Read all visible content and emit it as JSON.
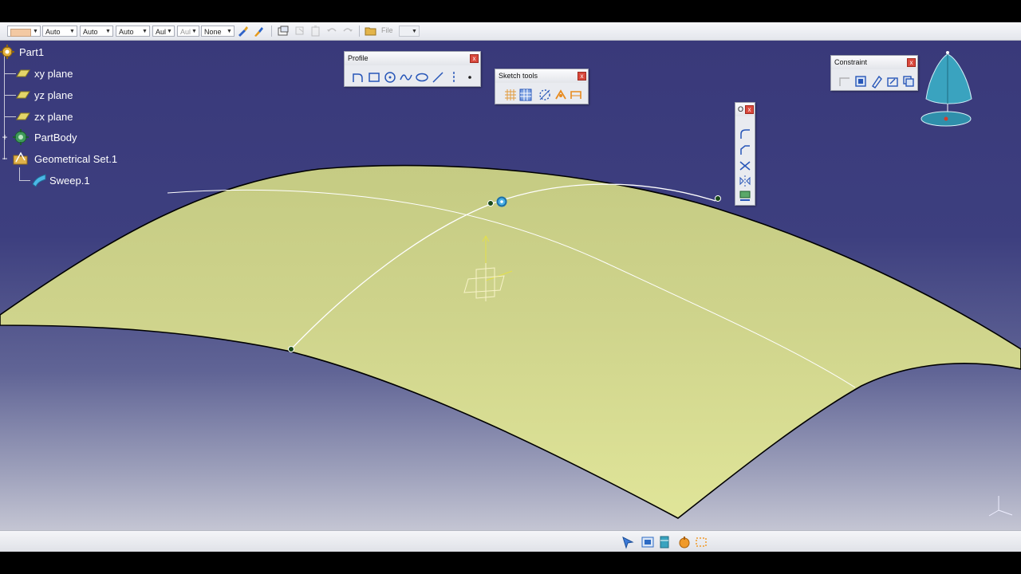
{
  "toolbar": {
    "combos": [
      {
        "name": "color-combo",
        "value": ""
      },
      {
        "name": "transparency-combo",
        "value": "Auto"
      },
      {
        "name": "linewidth-combo",
        "value": "Auto"
      },
      {
        "name": "linetype-combo",
        "value": "Auto"
      },
      {
        "name": "layer-combo",
        "value": "Aul"
      },
      {
        "name": "render-combo",
        "value": "Aul"
      },
      {
        "name": "filter-combo",
        "value": "None"
      }
    ],
    "file_label": "File"
  },
  "tree": {
    "root": "Part1",
    "items": [
      {
        "label": "xy plane",
        "icon": "plane-icon"
      },
      {
        "label": "yz plane",
        "icon": "plane-icon"
      },
      {
        "label": "zx plane",
        "icon": "plane-icon"
      },
      {
        "label": "PartBody",
        "icon": "partbody-icon"
      },
      {
        "label": "Geometrical Set.1",
        "icon": "geometrical-set-icon"
      },
      {
        "label": "Sweep.1",
        "icon": "sweep-icon"
      }
    ]
  },
  "toolbars": {
    "profile": {
      "title": "Profile",
      "close": "x"
    },
    "sketch_tools": {
      "title": "Sketch tools",
      "close": "x"
    },
    "constraint": {
      "title": "Constraint",
      "close": "x"
    },
    "operation": {
      "title": "O",
      "close": "x"
    }
  },
  "colors": {
    "background_top": "#39397a",
    "background_bottom": "#c4c5d3",
    "surface": "#d5dc8e",
    "curve": "#ffffff",
    "close_button": "#d9483c"
  }
}
